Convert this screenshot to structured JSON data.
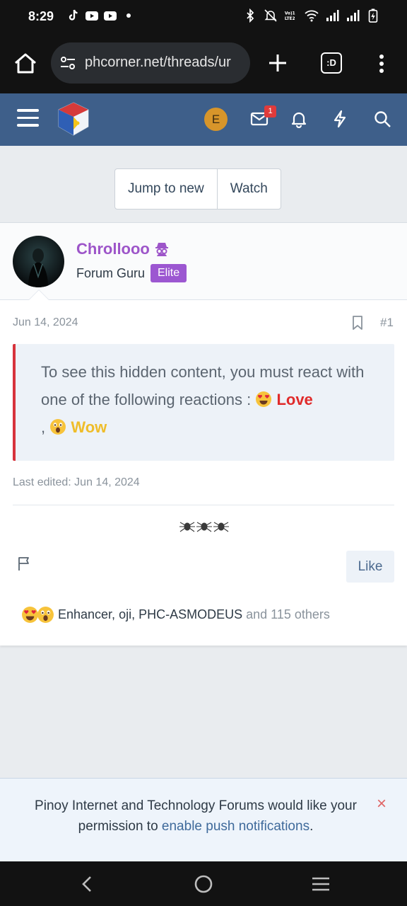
{
  "status_bar": {
    "time": "8:29",
    "left_icons": [
      "tiktok-icon",
      "youtube-icon",
      "youtube-icon",
      "dot-icon"
    ],
    "right_icons": [
      "bluetooth-icon",
      "mute-icon",
      "volte-icon",
      "wifi-icon",
      "signal-icon",
      "signal-icon",
      "battery-charging-icon"
    ],
    "volte_label": "Vo) LTE2"
  },
  "browser": {
    "url": "phcorner.net/threads/ur",
    "tabs_label": ":D"
  },
  "site_header": {
    "user_initial": "E",
    "inbox_badge": "1"
  },
  "thread_actions": {
    "jump_label": "Jump to new",
    "watch_label": "Watch"
  },
  "post": {
    "username": "Chrollooo",
    "user_title": "Forum Guru",
    "user_badge": "Elite",
    "date": "Jun 14, 2024",
    "post_number": "#1",
    "hidden_notice": "To see this hidden content, you must react with one of the following reactions :",
    "reaction_love": "Love",
    "reaction_sep": ",",
    "reaction_wow": "Wow",
    "last_edited": "Last edited: Jun 14, 2024",
    "like_label": "Like",
    "reacted_users": "Enhancer, oji, PHC-ASMODEUS",
    "reacted_others": "and 115 others"
  },
  "push_banner": {
    "text_before": "Pinoy Internet and Technology Forums would like your permission to",
    "link_text": "enable push notifications",
    "text_after": ".",
    "close": "×"
  },
  "colors": {
    "header_bg": "#3e5f8a",
    "username": "#9d55c9",
    "elite_badge": "#9c57d1",
    "hidden_border": "#d7333c",
    "love": "#e02b2b",
    "wow": "#efbd2a"
  }
}
